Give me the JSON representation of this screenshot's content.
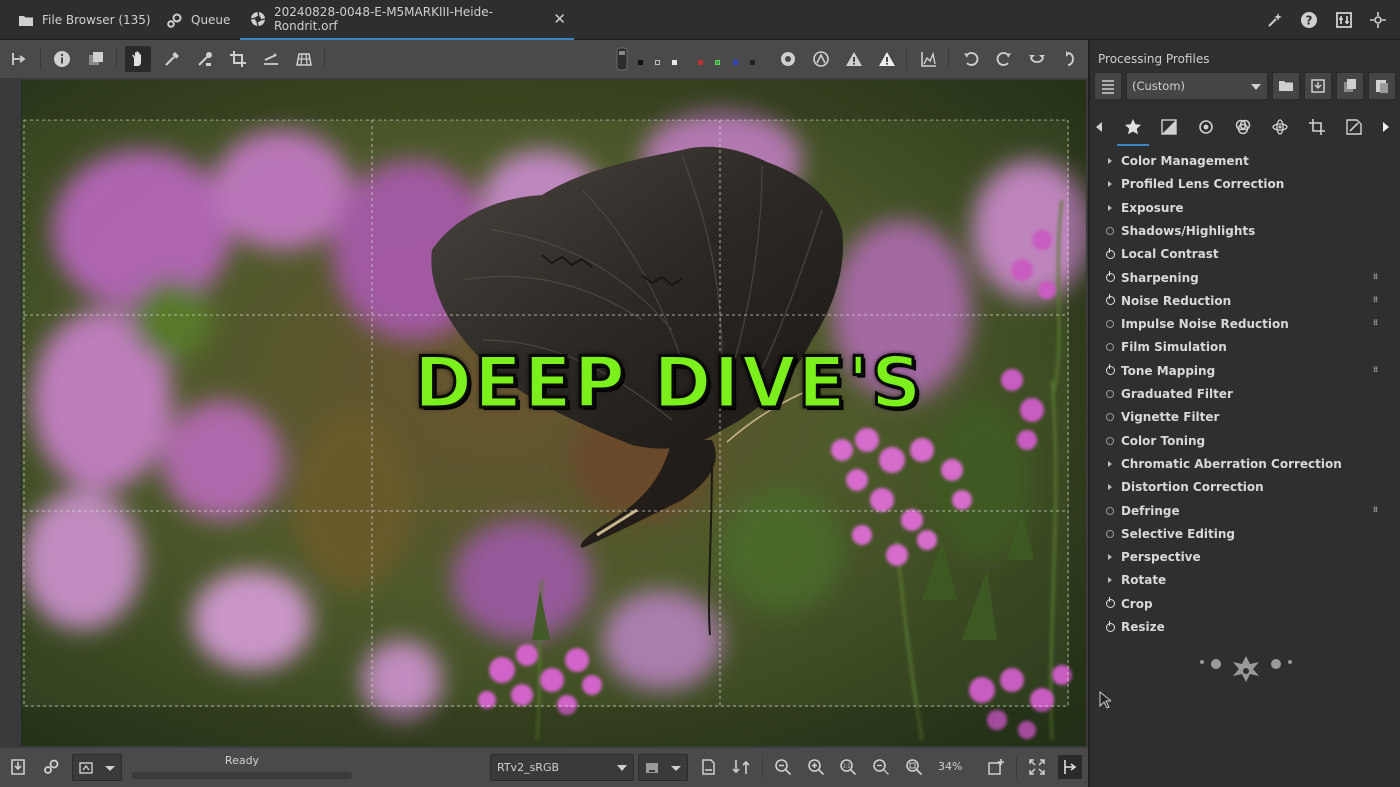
{
  "tabs": [
    {
      "label": "File Browser (135)",
      "icon": "folder-icon"
    },
    {
      "label": "Queue",
      "icon": "gears-icon"
    },
    {
      "label": "20240828-0048-E-M5MARKIII-Heide-Rondrit.orf",
      "icon": "aperture-icon",
      "active": true,
      "close": "✕"
    }
  ],
  "photo": {
    "overlay_text": "DEEP DIVE'S",
    "overlay_color": "#7cf01c",
    "subject": "butterfly-on-heather"
  },
  "status": {
    "text": "Ready",
    "color_profile": "RTv2_sRGB",
    "zoom": "34%"
  },
  "panel": {
    "title": "Processing Profiles",
    "profile": "(Custom)",
    "accent": "#3b84c5",
    "tools": [
      {
        "label": "Color Management",
        "marker": "arrow",
        "flag": false
      },
      {
        "label": "Profiled Lens Correction",
        "marker": "arrow",
        "flag": false
      },
      {
        "label": "Exposure",
        "marker": "arrow",
        "flag": false
      },
      {
        "label": "Shadows/Highlights",
        "marker": "power-off",
        "flag": false
      },
      {
        "label": "Local Contrast",
        "marker": "power-on",
        "flag": false
      },
      {
        "label": "Sharpening",
        "marker": "power-on",
        "flag": true
      },
      {
        "label": "Noise Reduction",
        "marker": "power-on",
        "flag": true
      },
      {
        "label": "Impulse Noise Reduction",
        "marker": "power-off",
        "flag": true
      },
      {
        "label": "Film Simulation",
        "marker": "power-off",
        "flag": false
      },
      {
        "label": "Tone Mapping",
        "marker": "power-on",
        "flag": true
      },
      {
        "label": "Graduated Filter",
        "marker": "power-off",
        "flag": false
      },
      {
        "label": "Vignette Filter",
        "marker": "power-off",
        "flag": false
      },
      {
        "label": "Color Toning",
        "marker": "power-off",
        "flag": false
      },
      {
        "label": "Chromatic Aberration Correction",
        "marker": "arrow",
        "flag": false
      },
      {
        "label": "Distortion Correction",
        "marker": "arrow",
        "flag": false
      },
      {
        "label": "Defringe",
        "marker": "power-off",
        "flag": true
      },
      {
        "label": "Selective Editing",
        "marker": "power-off",
        "flag": false
      },
      {
        "label": "Perspective",
        "marker": "arrow",
        "flag": false
      },
      {
        "label": "Rotate",
        "marker": "arrow",
        "flag": false
      },
      {
        "label": "Crop",
        "marker": "power-on",
        "flag": false
      },
      {
        "label": "Resize",
        "marker": "power-on",
        "flag": false
      }
    ],
    "flag_glyph": "⁞⁞"
  }
}
